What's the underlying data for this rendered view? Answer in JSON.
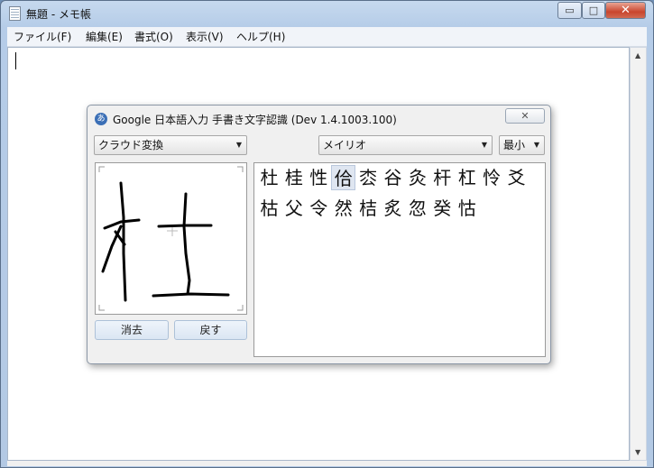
{
  "window": {
    "title": "無題 - メモ帳",
    "controls": {
      "minimize": "▭",
      "maximize": "□",
      "close": "✕"
    }
  },
  "menu": [
    "ファイル(F)",
    "編集(E)",
    "書式(O)",
    "表示(V)",
    "ヘルプ(H)"
  ],
  "editor": {
    "text": ""
  },
  "ime": {
    "icon_glyph": "あ",
    "title": "Google 日本語入力 手書き文字認識 (Dev 1.4.1003.100)",
    "close_label": "✕",
    "mode_select": "クラウド変換",
    "font_select": "メイリオ",
    "size_select": "最小",
    "clear_button": "消去",
    "undo_button": "戻す",
    "candidates_row1": [
      "杜",
      "桂",
      "性",
      "佮",
      "枩",
      "谷",
      "灸",
      "杆",
      "杠",
      "怜",
      "爻"
    ],
    "candidates_row2": [
      "枯",
      "父",
      "令",
      "然",
      "桔",
      "炙",
      "忽",
      "癸",
      "怙"
    ],
    "highlighted_candidate": "佮"
  }
}
